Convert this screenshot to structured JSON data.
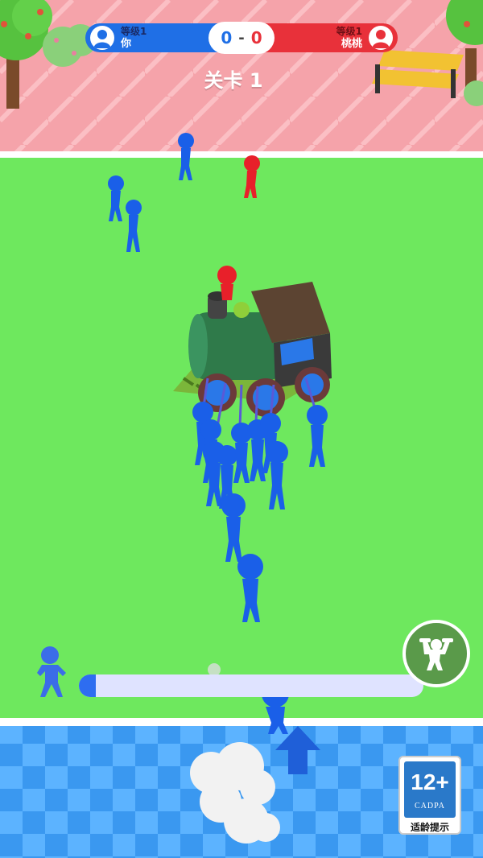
{
  "hud": {
    "player_left": {
      "level_label": "等级1",
      "name": "你"
    },
    "player_right": {
      "level_label": "等级1",
      "name": "桃桃"
    },
    "score_left": "0",
    "score_sep": "-",
    "score_right": "0",
    "level_title": "关卡 1"
  },
  "progress": {
    "fraction": 0.05
  },
  "boost_button": {
    "icon": "strongman-icon"
  },
  "age_rating": {
    "rating": "12+",
    "org": "CADPA",
    "tip": "适龄提示"
  },
  "colors": {
    "team_blue": "#1f6fe6",
    "team_red": "#e8313a",
    "field": "#6ee85e",
    "plaza": "#f7a8ae",
    "pool": "#3a9cf0"
  }
}
